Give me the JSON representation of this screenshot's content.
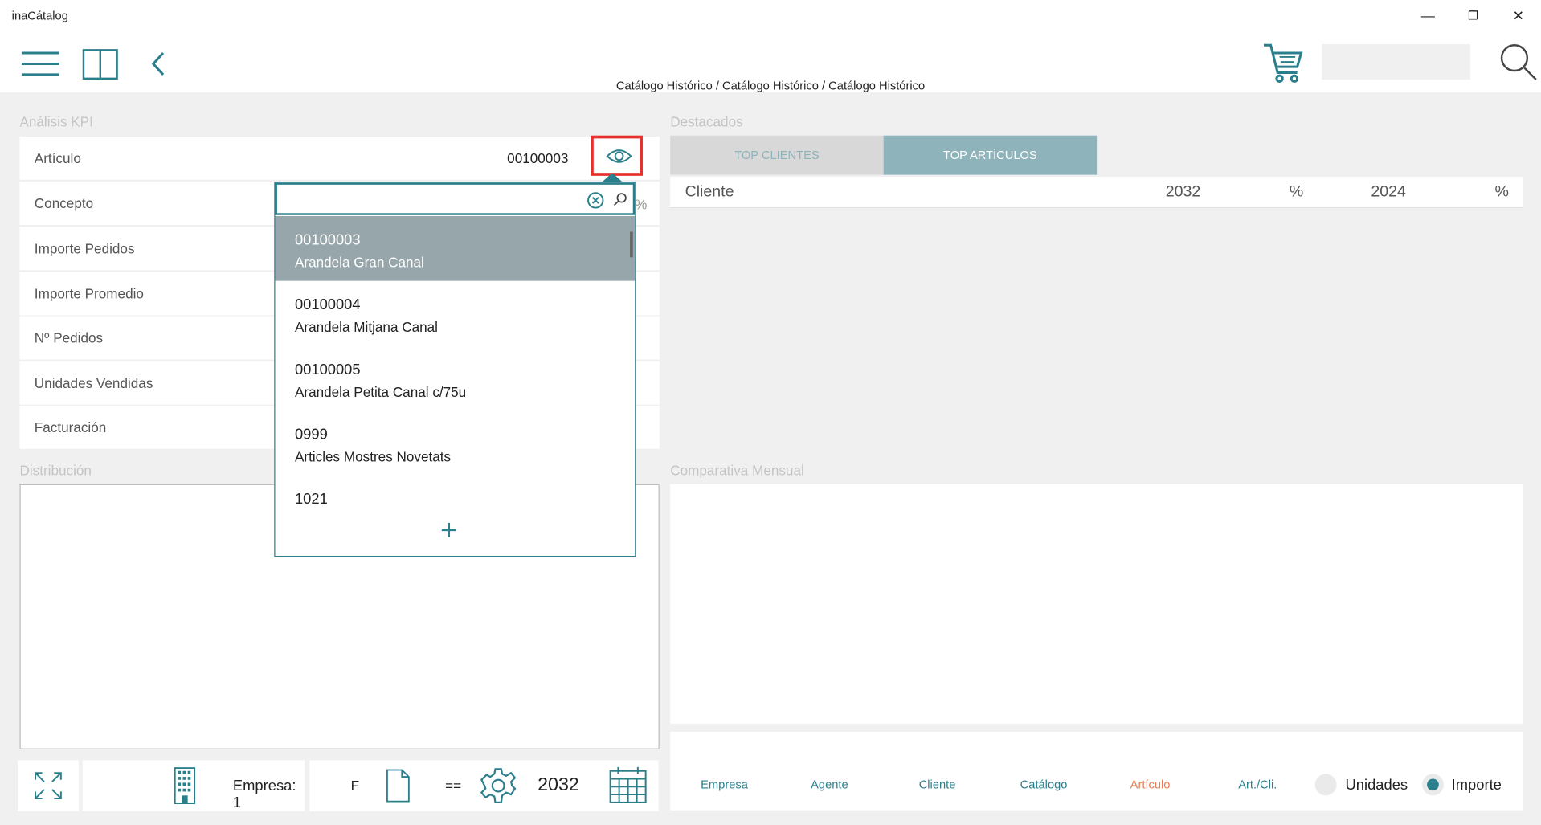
{
  "app": {
    "title": "inaCátalog"
  },
  "window": {
    "minimize": "—",
    "restore": "❐",
    "close": "✕"
  },
  "breadcrumb": "Catálogo Histórico / Catálogo Histórico / Catálogo Histórico",
  "kpi": {
    "section_title": "Análisis KPI",
    "rows": [
      {
        "label": "Artículo",
        "value": "00100003"
      },
      {
        "label": "Concepto",
        "value": "%"
      },
      {
        "label": "Importe Pedidos"
      },
      {
        "label": "Importe Promedio"
      },
      {
        "label": "Nº Pedidos"
      },
      {
        "label": "Unidades Vendidas"
      },
      {
        "label": "Facturación"
      }
    ]
  },
  "dropdown": {
    "search_value": "",
    "items": [
      {
        "code": "00100003",
        "name": "Arandela Gran Canal",
        "selected": true
      },
      {
        "code": "00100004",
        "name": "Arandela Mitjana Canal"
      },
      {
        "code": "00100005",
        "name": "Arandela Petita Canal c/75u"
      },
      {
        "code": "0999",
        "name": "Articles Mostres Novetats"
      },
      {
        "code": "1021",
        "name": ""
      }
    ],
    "add_label": "+"
  },
  "destacados": {
    "section_title": "Destacados",
    "tabs": [
      "TOP CLIENTES",
      "TOP ARTÍCULOS"
    ],
    "active_tab": 1,
    "columns": [
      "Cliente",
      "2032",
      "%",
      "2024",
      "%"
    ]
  },
  "distribucion": {
    "section_title": "Distribución"
  },
  "comparativa": {
    "section_title": "Comparativa Mensual"
  },
  "bottom": {
    "empresa": "Empresa: 1",
    "f_label": "F",
    "eq_label": "==",
    "year": "2032"
  },
  "nav": {
    "links": [
      "Empresa",
      "Agente",
      "Cliente",
      "Catálogo",
      "Artículo",
      "Art./Cli."
    ],
    "active_link": 4,
    "radio": [
      {
        "label": "Unidades",
        "checked": false
      },
      {
        "label": "Importe",
        "checked": true
      }
    ]
  },
  "colors": {
    "accent": "#2b7f8c",
    "tab_active": "#8fb3ba",
    "tab_inactive": "#d8d8d8",
    "highlight": "#e8302a",
    "active_link": "#f07a50"
  }
}
